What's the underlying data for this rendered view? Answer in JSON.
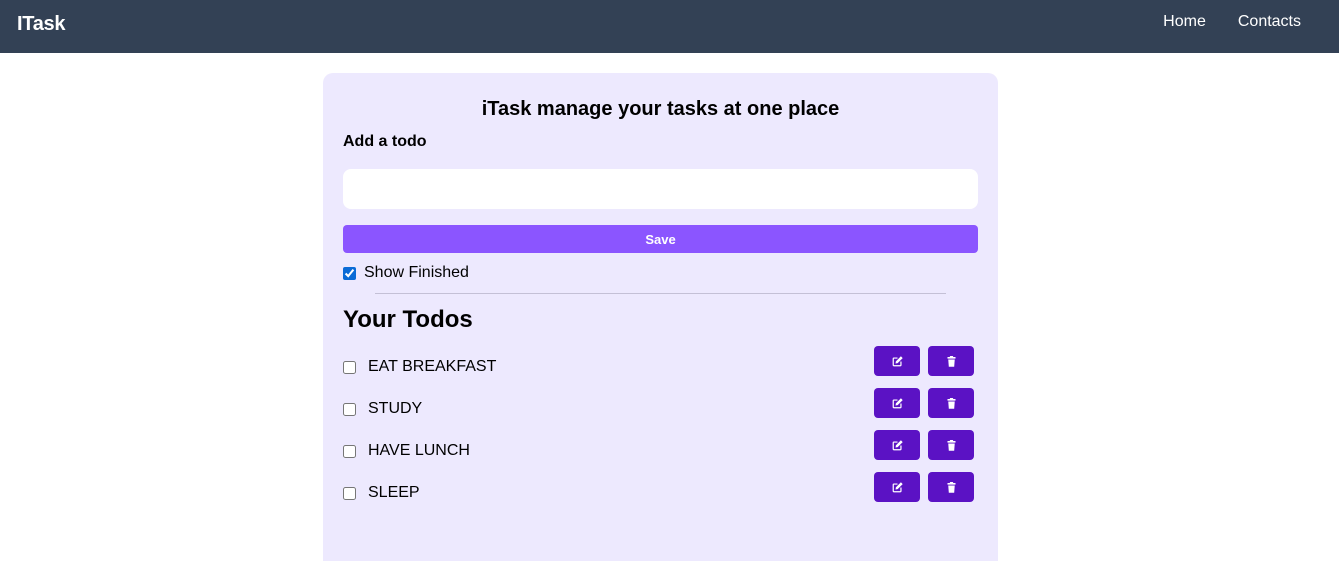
{
  "navbar": {
    "brand": "ITask",
    "links": [
      "Home",
      "Contacts"
    ]
  },
  "main": {
    "heading": "iTask manage your tasks at one place",
    "add_label": "Add a todo",
    "input_value": "",
    "save_label": "Save",
    "show_finished_label": "Show Finished",
    "show_finished_checked": true,
    "todos_title": "Your Todos",
    "todos": [
      {
        "text": "EAT BREAKFAST",
        "done": false
      },
      {
        "text": "STUDY",
        "done": false
      },
      {
        "text": "HAVE LUNCH",
        "done": false
      },
      {
        "text": "SLEEP",
        "done": false
      }
    ]
  },
  "colors": {
    "navbar": "#334155",
    "card": "#ede9fe",
    "save_button": "#8b55ff",
    "action_button": "#5b12c4"
  },
  "icons": {
    "edit": "edit-icon",
    "delete": "trash-icon"
  }
}
